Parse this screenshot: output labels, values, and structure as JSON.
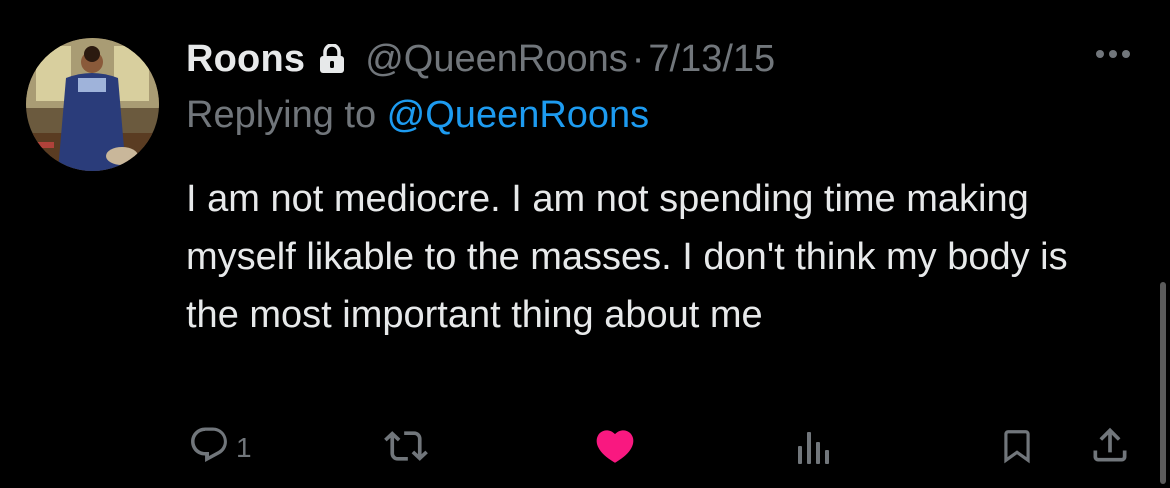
{
  "tweet": {
    "display_name": "Roons",
    "handle": "@QueenRoons",
    "separator": "·",
    "date": "7/13/15",
    "replying_prefix": "Replying to ",
    "replying_to": "@QueenRoons",
    "text": "I am not mediocre. I am not spending time making myself likable to the masses. I don't think my body is the most important thing about me",
    "reply_count": "1",
    "liked": true
  },
  "icons": {
    "lock": "lock-icon",
    "more": "more-icon",
    "reply": "reply-icon",
    "retweet": "retweet-icon",
    "like": "heart-icon",
    "views": "views-icon",
    "bookmark": "bookmark-icon",
    "share": "share-icon"
  },
  "colors": {
    "background": "#000000",
    "text": "#e7e9ea",
    "secondary": "#71767b",
    "link": "#1d9bf0",
    "like": "#f91880"
  }
}
